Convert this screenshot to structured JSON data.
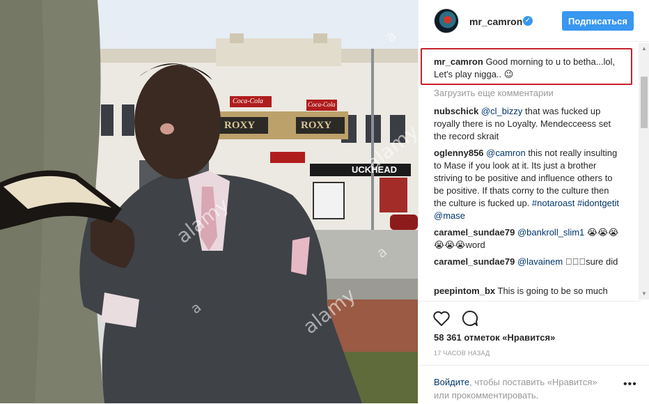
{
  "post": {
    "username": "mr_camron",
    "follow_label": "Подписаться",
    "caption": {
      "user": "mr_camron",
      "text": "Good morning to u to betha...lol, Let's play nigga.. 😉"
    },
    "load_more": "Загрузить еще комментарии",
    "comments": [
      {
        "user": "nubschick",
        "mention": "@cl_bizzy",
        "text": " that was fucked up royally there is no Loyalty. Mendecceess set the record skrait"
      },
      {
        "user": "oglenny856",
        "mention": "@camron",
        "text": " this not really insulting to Mase if you look at it. Its just a brother striving to be positive and influence others to be positive. If thats corny to the culture then the culture is fucked up. ",
        "tags": "#notaroast #idontgetit @mase"
      },
      {
        "user": "caramel_sundae79",
        "mention": "@bankroll_slim1",
        "text": " 😭😭😭😭😭😭word"
      },
      {
        "user": "caramel_sundae79",
        "mention": "@lavainem",
        "text": " 🏻🏻🏻sure did"
      },
      {
        "user": "peepintom_bx",
        "mention": "",
        "text": " This is going to be so much fun"
      }
    ],
    "likes": "58 361 отметок «Нравится»",
    "timestamp": "17 ЧАСОВ НАЗАД",
    "login_link": "Войдите",
    "login_text": ", чтобы поставить «Нравится» или прокомментировать.",
    "more_label": "•••"
  },
  "photo": {
    "marquee_left": "ROXY",
    "marquee_right": "ROXY",
    "sign_left": "Coca-Cola",
    "sign_right": "Coca-Cola",
    "sign_buckhead": "UCKHEAD",
    "watermark": "alamy",
    "watermark_letter": "a"
  },
  "colors": {
    "accent": "#3897f0",
    "highlight_border": "#c9212a",
    "mention": "#003569"
  }
}
